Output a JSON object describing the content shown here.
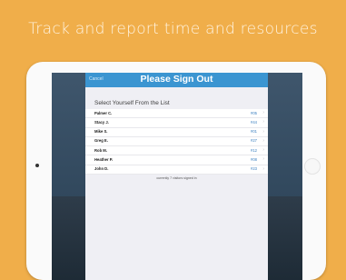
{
  "headline": "Track and report time and resources",
  "modal": {
    "cancel_label": "Cancel",
    "title": "Please Sign Out",
    "section_header": "Select Yourself From the List",
    "footer_status": "currently 7 visitors signed in"
  },
  "people": [
    {
      "name": "Palmer C.",
      "id": "#05"
    },
    {
      "name": "Stacy J.",
      "id": "#44"
    },
    {
      "name": "Mike S.",
      "id": "#01"
    },
    {
      "name": "Greg E.",
      "id": "#27"
    },
    {
      "name": "Rob M.",
      "id": "#12"
    },
    {
      "name": "Heather P.",
      "id": "#08"
    },
    {
      "name": "John D.",
      "id": "#23"
    }
  ],
  "icons": {
    "row_disclosure": "chevron-right-icon"
  },
  "colors": {
    "background": "#F0AE4A",
    "navbar": "#3B95D1",
    "id_text": "#3A7FC0"
  }
}
